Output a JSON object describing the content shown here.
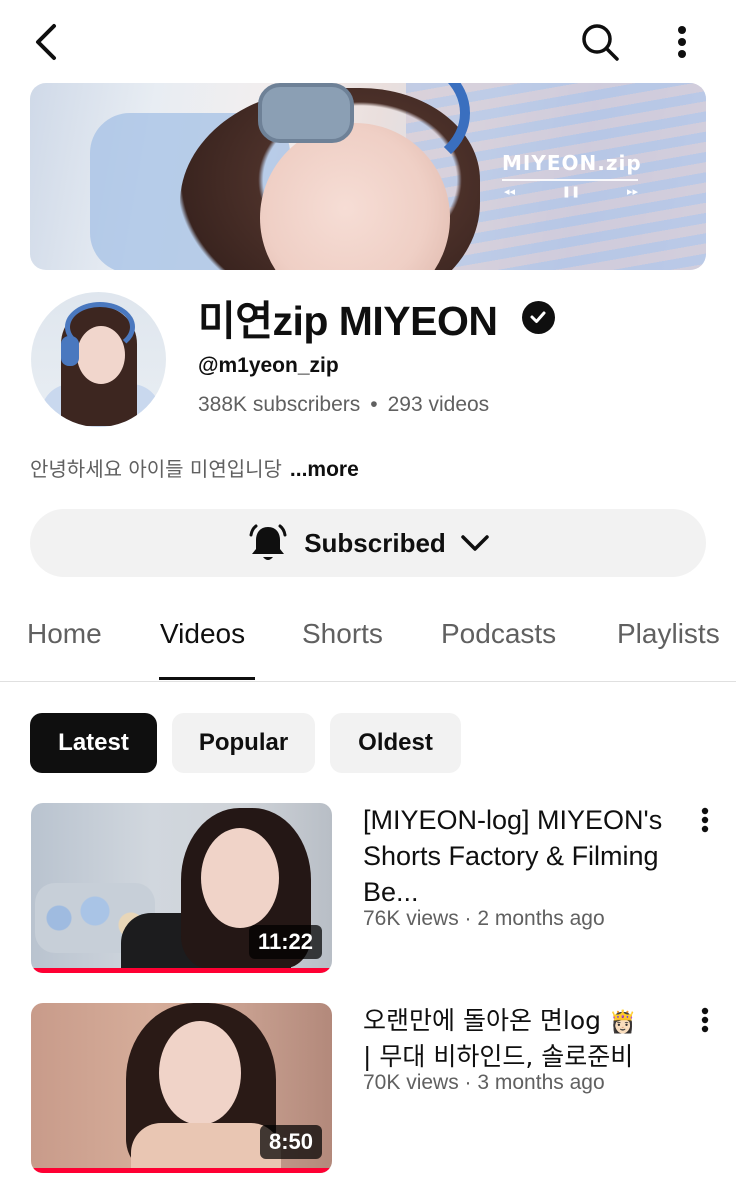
{
  "topbar": {
    "back_icon": "chevron-left-icon",
    "search_icon": "search-icon",
    "more_icon": "more-vertical-icon"
  },
  "banner": {
    "logo_text": "MIYEON.zip",
    "controls": [
      "◂◂",
      "❚❚",
      "▸▸"
    ]
  },
  "channel": {
    "name": "미연zip MIYEON",
    "verified": true,
    "handle": "@m1yeon_zip",
    "subscribers": "388K subscribers",
    "separator": "•",
    "videos": "293 videos",
    "description": "안녕하세요 아이들 미연입니당",
    "more_label": "...more"
  },
  "subscribe": {
    "label": "Subscribed",
    "bell_icon": "bell-icon",
    "dropdown_icon": "chevron-down-icon"
  },
  "tabs": [
    {
      "label": "Home",
      "active": false
    },
    {
      "label": "Videos",
      "active": true
    },
    {
      "label": "Shorts",
      "active": false
    },
    {
      "label": "Podcasts",
      "active": false
    },
    {
      "label": "Playlists",
      "active": false
    }
  ],
  "chips": [
    {
      "label": "Latest",
      "active": true
    },
    {
      "label": "Popular",
      "active": false
    },
    {
      "label": "Oldest",
      "active": false
    }
  ],
  "videos": [
    {
      "title": "[MIYEON-log] MIYEON's Shorts Factory & Filming Be...",
      "meta": "76K views · 2 months ago",
      "duration": "11:22",
      "watched": 1.0
    },
    {
      "title": "오랜만에 돌아온 면log",
      "title_emoji": "👸🏻",
      "title_line2": "| 무대 비하인드, 솔로준비",
      "meta": "70K views · 3 months ago",
      "duration": "8:50",
      "watched": 1.0
    }
  ],
  "colors": {
    "accent_red": "#ff0033",
    "text_primary": "#0f0f0f",
    "text_secondary": "#606060",
    "chip_bg": "#f2f2f2"
  }
}
